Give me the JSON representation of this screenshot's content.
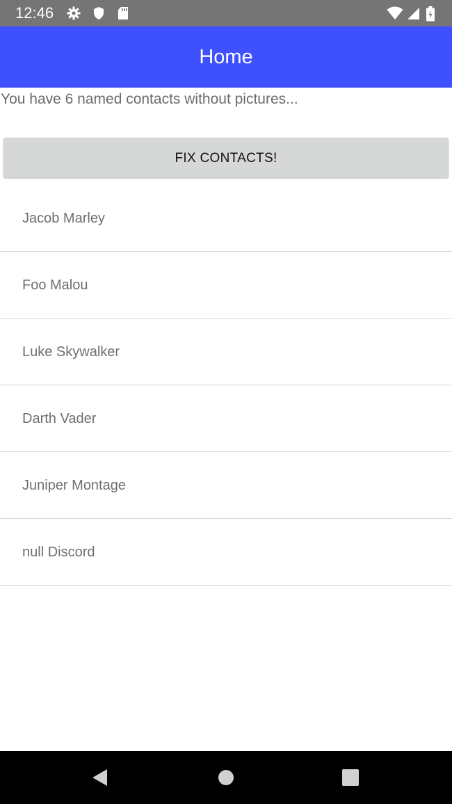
{
  "status_bar": {
    "time": "12:46",
    "left_icons": [
      "gear-icon",
      "shield-icon",
      "sd-card-icon"
    ],
    "right_icons": [
      "wifi-icon",
      "signal-icon",
      "battery-icon"
    ]
  },
  "app_bar": {
    "title": "Home",
    "color": "#3f51ff"
  },
  "main": {
    "summary": "You have 6 named contacts without pictures...",
    "fix_button_label": "FIX CONTACTS!",
    "contacts": [
      {
        "name": "Jacob Marley"
      },
      {
        "name": "Foo Malou"
      },
      {
        "name": "Luke Skywalker"
      },
      {
        "name": "Darth Vader"
      },
      {
        "name": "Juniper Montage"
      },
      {
        "name": "null Discord"
      }
    ]
  },
  "nav_bar": {
    "buttons": [
      "back-icon",
      "home-icon",
      "recents-icon"
    ]
  }
}
